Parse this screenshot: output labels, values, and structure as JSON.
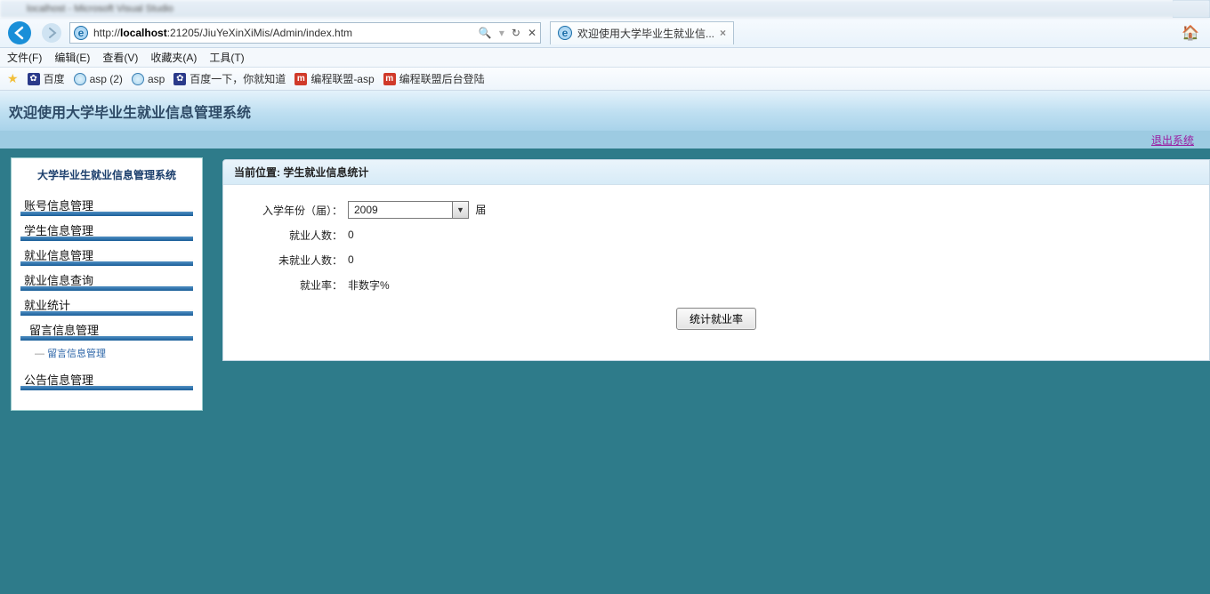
{
  "browser": {
    "title_blur": "localhost - Microsoft Visual Studio",
    "url_prefix": "http://",
    "url_host": "localhost",
    "url_rest": ":21205/JiuYeXinXiMis/Admin/index.htm",
    "tab_title": "欢迎使用大学毕业生就业信...",
    "menus": [
      "文件(F)",
      "编辑(E)",
      "查看(V)",
      "收藏夹(A)",
      "工具(T)"
    ],
    "favorites": [
      {
        "icon": "paw",
        "label": "百度"
      },
      {
        "icon": "ie",
        "label": "asp (2)"
      },
      {
        "icon": "ie",
        "label": "asp"
      },
      {
        "icon": "paw",
        "label": "百度一下，你就知道"
      },
      {
        "icon": "m",
        "label": "编程联盟-asp"
      },
      {
        "icon": "m",
        "label": "编程联盟后台登陆"
      }
    ]
  },
  "header": {
    "title": "欢迎使用大学毕业生就业信息管理系统",
    "logout": "退出系统"
  },
  "sidebar": {
    "title": "大学毕业生就业信息管理系统",
    "items": [
      "账号信息管理",
      "学生信息管理",
      "就业信息管理",
      "就业信息查询",
      "就业统计",
      "留言信息管理"
    ],
    "sub_message": "留言信息管理",
    "item_notice": "公告信息管理"
  },
  "main": {
    "crumb_label": "当前位置:",
    "crumb_value": "学生就业信息统计",
    "year_label": "入学年份（届）：",
    "year_value": "2009",
    "year_suffix": "届",
    "employed_label": "就业人数：",
    "employed_value": "0",
    "unemployed_label": "未就业人数：",
    "unemployed_value": "0",
    "rate_label": "就业率：",
    "rate_value": "非数字%",
    "button": "统计就业率"
  }
}
